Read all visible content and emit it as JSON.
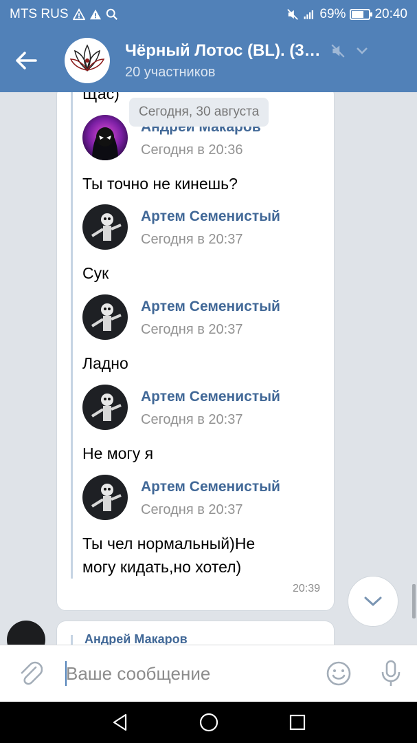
{
  "status_bar": {
    "carrier": "MTS RUS",
    "battery": "69%",
    "battery_level": 0.69,
    "time": "20:40"
  },
  "header": {
    "title": "Чёрный Лотос (BL). (3…",
    "subtitle": "20 участников"
  },
  "chat": {
    "date_label": "Сегодня, 30 августа",
    "first_text": "Щас)",
    "forwarded": [
      {
        "author": "Андрей Макаров",
        "time": "Сегодня в 20:36",
        "text": "Ты точно не кинешь?",
        "avatar": "spider-avatar"
      },
      {
        "author": "Артем Семенистый",
        "time": "Сегодня в 20:37",
        "text": "Сук",
        "avatar": "skeleton-avatar"
      },
      {
        "author": "Артем Семенистый",
        "time": "Сегодня в 20:37",
        "text": "Ладно",
        "avatar": "skeleton-avatar"
      },
      {
        "author": "Артем Семенистый",
        "time": "Сегодня в 20:37",
        "text": "Не могу я",
        "avatar": "skeleton-avatar"
      },
      {
        "author": "Артем Семенистый",
        "time": "Сегодня в 20:37",
        "text_line1": "Ты чел нормальный)Не",
        "text_line2": "могу кидать,но хотел)",
        "avatar": "skeleton-avatar"
      }
    ],
    "message_time": "20:39",
    "next_author": "Андрей Макаров"
  },
  "input": {
    "placeholder": "Ваше сообщение"
  },
  "colors": {
    "accent": "#5181b8",
    "link": "#416897"
  }
}
